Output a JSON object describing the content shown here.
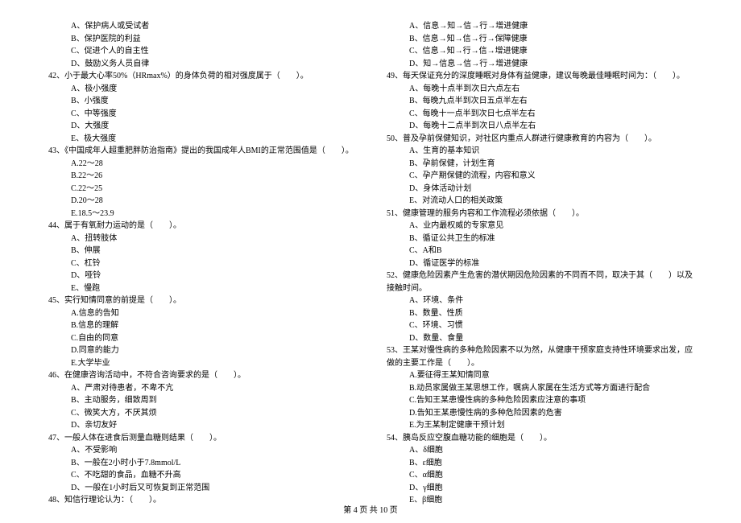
{
  "leftColumn": {
    "q41_options": {
      "a": "A、保护病人或受试者",
      "b": "B、保护医院的利益",
      "c": "C、促进个人的自主性",
      "d": "D、鼓励义务人员自律"
    },
    "q42": {
      "text": "42、小于最大心率50%（HRmax%）的身体负荷的相对强度属于（　　）。",
      "a": "A、极小强度",
      "b": "B、小强度",
      "c": "C、中等强度",
      "d": "D、大强度",
      "e": "E、极大强度"
    },
    "q43": {
      "text": "43、《中国成年人超重肥胖防治指南》提出的我国成年人BMI的正常范围值是（　　）。",
      "a": "A.22～28",
      "b": "B.22～26",
      "c": "C.22～25",
      "d": "D.20～28",
      "e": "E.18.5～23.9"
    },
    "q44": {
      "text": "44、属于有氧耐力运动的是（　　）。",
      "a": "A、扭转肢体",
      "b": "B、伸展",
      "c": "C、杠铃",
      "d": "D、哑铃",
      "e": "E、慢跑"
    },
    "q45": {
      "text": "45、实行知情同意的前提是（　　）。",
      "a": "A.信息的告知",
      "b": "B.信息的理解",
      "c": "C.自由的同意",
      "d": "D.同意的能力",
      "e": "E.大学毕业"
    },
    "q46": {
      "text": "46、在健康咨询活动中，不符合咨询要求的是（　　）。",
      "a": "A、严肃对待患者，不卑不亢",
      "b": "B、主动服务，细致周到",
      "c": "C、微笑大方，不厌其烦",
      "d": "D、亲切友好"
    },
    "q47": {
      "text": "47、一般人体在进食后测量血糖则结果（　　）。",
      "a": "A、不受影响",
      "b": "B、一般在2小时小于7.8mmol/L",
      "c": "C、不吃甜的食品，血糖不升高",
      "d": "D、一般在1小时后又可恢复到正常范围"
    },
    "q48": {
      "text": "48、知信行理论认为：（　　）。"
    }
  },
  "rightColumn": {
    "q48_options": {
      "a": "A、信息→知→信→行→增进健康",
      "b": "B、信息→知→信→行→保障健康",
      "c": "C、信息→知→行→信→增进健康",
      "d": "D、知→信息→信→行→增进健康"
    },
    "q49": {
      "text": "49、每天保证充分的深度睡眠对身体有益健康，建议每晚最佳睡眠时间为：（　　）。",
      "a": "A、每晚十点半到次日六点左右",
      "b": "B、每晚九点半到次日五点半左右",
      "c": "C、每晚十一点半到次日七点半左右",
      "d": "D、每晚十二点半到次日八点半左右"
    },
    "q50": {
      "text": "50、普及孕前保健知识，对社区内重点人群进行健康教育的内容为（　　）。",
      "a": "A、生育的基本知识",
      "b": "B、孕前保健，计划生育",
      "c": "C、孕产期保健的流程，内容和意义",
      "d": "D、身体活动计划",
      "e": "E、对流动人口的相关政策"
    },
    "q51": {
      "text": "51、健康管理的服务内容和工作流程必须依据（　　）。",
      "a": "A、业内最权威的专家意见",
      "b": "B、循证公共卫生的标准",
      "c": "C、A和B",
      "d": "D、循证医学的标准"
    },
    "q52": {
      "text": "52、健康危险因素产生危害的潜伏期因危险因素的不同而不同，取决于其（　　）以及接触时间。",
      "a": "A、环境、条件",
      "b": "B、数量、性质",
      "c": "C、环境、习惯",
      "d": "D、数量、食量"
    },
    "q53": {
      "text": "53、王某对慢性病的多种危险因素不以为然，从健康干预家庭支持性环境要求出发，应做的主要工作是（　　）。",
      "a": "A.要征得王某知情同意",
      "b": "B.动员家属做王某思想工作，嘱病人家属在生活方式等方面进行配合",
      "c": "C.告知王某患慢性病的多种危险因素应注意的事项",
      "d": "D.告知王某患慢性病的多种危险因素的危害",
      "e": "E.为王某制定健康干预计划"
    },
    "q54": {
      "text": "54、胰岛反应空腹血糖功能的细胞是（　　）。",
      "a": "A、δ细胞",
      "b": "B、ε细胞",
      "c": "C、α细胞",
      "d": "D、γ细胞",
      "e": "E、β细胞"
    }
  },
  "footer": "第 4 页 共 10 页"
}
